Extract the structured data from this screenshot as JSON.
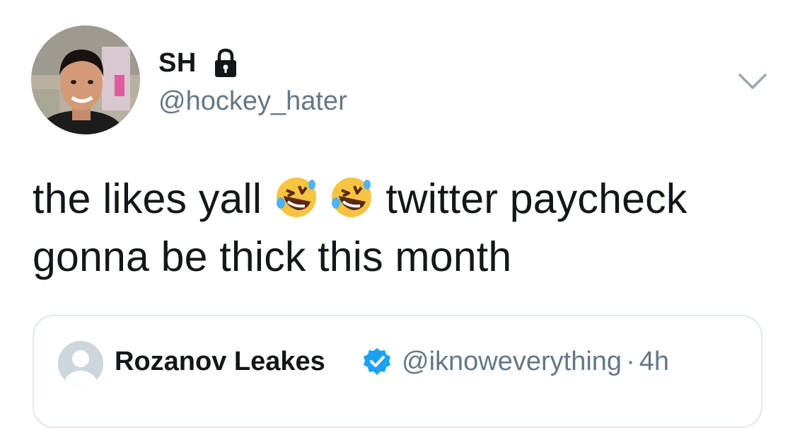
{
  "tweet": {
    "display_name": "SH",
    "handle": "@hockey_hater",
    "text_part1": "the likes yall ",
    "text_part2": " twitter paycheck gonna be thick this month",
    "emoji_1": "rolling-on-floor-laughing",
    "emoji_2": "rolling-on-floor-laughing",
    "protected": true,
    "menu_icon": "chevron-down-icon"
  },
  "quote": {
    "display_name": "Rozanov Leakes",
    "handle": "@iknoweverything",
    "separator": "·",
    "time": "4h",
    "verified": true,
    "verified_color": "#1da1f2"
  },
  "colors": {
    "text": "#14171a",
    "secondary": "#657786",
    "border": "#e1e8ed",
    "verified": "#1da1f2"
  }
}
